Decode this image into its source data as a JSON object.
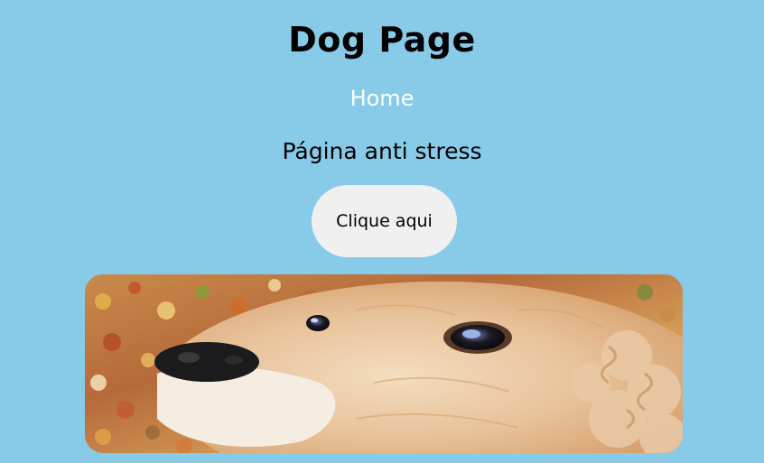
{
  "page": {
    "title": "Dog Page",
    "nav_home": "Home",
    "subtitle": "Página anti stress",
    "button_label": "Clique aqui"
  },
  "colors": {
    "background": "#87CBE9",
    "button_bg": "#F0F0F0",
    "link": "#FFFFFF"
  },
  "image": {
    "subject": "close-up of a golden cocker spaniel dog resting on autumn leaves"
  }
}
